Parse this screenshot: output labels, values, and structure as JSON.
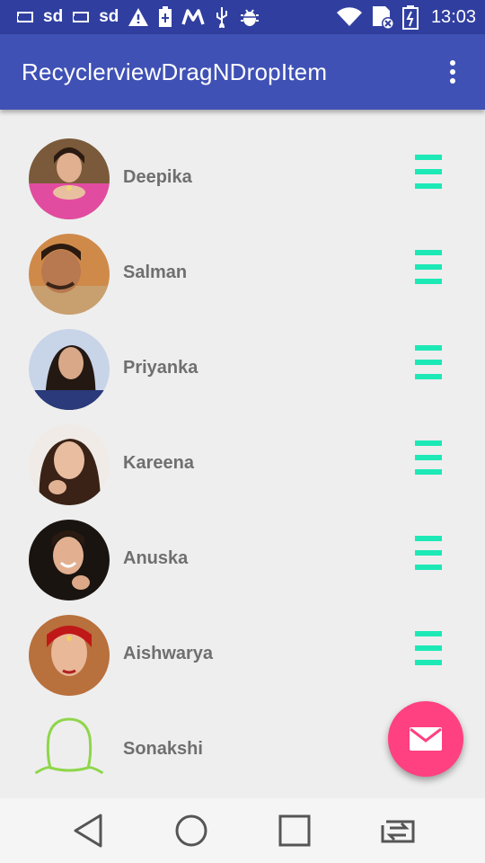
{
  "status_bar": {
    "left_text_1": "sd",
    "left_text_2": "sd",
    "time": "13:03",
    "icons": [
      "screen-icon",
      "sd-card",
      "screen-icon",
      "sd-card",
      "warning-icon",
      "battery-saver-icon",
      "m-app-icon",
      "usb-icon",
      "android-debug-icon",
      "wifi-icon",
      "sim-blocked-icon",
      "battery-charging-icon"
    ]
  },
  "app_bar": {
    "title": "RecyclerviewDragNDropItem",
    "menu_icon": "more-vert-icon"
  },
  "list": {
    "items": [
      {
        "name": "Deepika",
        "avatar": "photo"
      },
      {
        "name": "Salman",
        "avatar": "photo"
      },
      {
        "name": "Priyanka",
        "avatar": "photo"
      },
      {
        "name": "Kareena",
        "avatar": "photo"
      },
      {
        "name": "Anuska",
        "avatar": "photo"
      },
      {
        "name": "Aishwarya",
        "avatar": "photo"
      },
      {
        "name": "Sonakshi",
        "avatar": "placeholder-person-outline"
      }
    ]
  },
  "fab": {
    "icon": "email-icon"
  },
  "nav_bar": {
    "icons": [
      "back-icon",
      "home-icon",
      "recents-icon",
      "switch-icon"
    ]
  },
  "colors": {
    "status_bar": "#303f9f",
    "app_bar": "#3f51b5",
    "drag_handle": "#1de9b6",
    "fab": "#ff4081",
    "name_text": "#6f6f6f",
    "background": "#eeeeee"
  }
}
